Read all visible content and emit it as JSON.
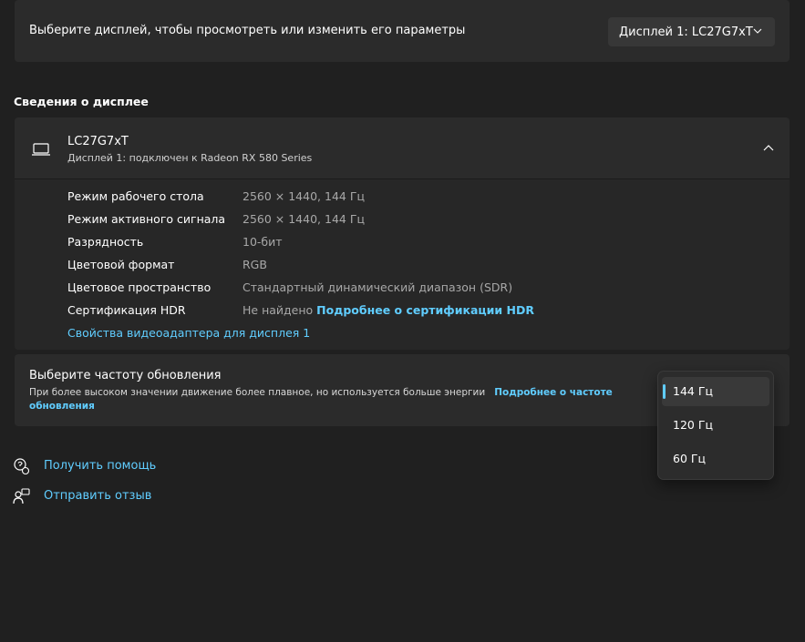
{
  "display_select": {
    "prompt": "Выберите дисплей, чтобы просмотреть или изменить его параметры",
    "selected": "Дисплей 1: LC27G7xT"
  },
  "section_title": "Сведения о дисплее",
  "monitor": {
    "name": "LC27G7xT",
    "subtitle": "Дисплей 1: подключен к Radeon RX 580 Series"
  },
  "details": [
    {
      "label": "Режим рабочего стола",
      "value": "2560 × 1440, 144 Гц"
    },
    {
      "label": "Режим активного сигнала",
      "value": "2560 × 1440, 144 Гц"
    },
    {
      "label": "Разрядность",
      "value": "10-бит"
    },
    {
      "label": "Цветовой формат",
      "value": "RGB"
    },
    {
      "label": "Цветовое пространство",
      "value": "Стандартный динамический диапазон (SDR)"
    },
    {
      "label": "Сертификация HDR",
      "value": "Не найдено",
      "link": "Подробнее о сертификации HDR"
    }
  ],
  "adapter_link": "Свойства видеоадаптера для дисплея 1",
  "refresh": {
    "title": "Выберите частоту обновления",
    "description": "При более высоком значении движение более плавное, но используется больше энергии",
    "link": "Подробнее о частоте обновления",
    "options": [
      "144 Гц",
      "120 Гц",
      "60 Гц"
    ],
    "selected": "144 Гц"
  },
  "help": {
    "get_help": "Получить помощь",
    "feedback": "Отправить отзыв"
  },
  "colors": {
    "background": "#202020",
    "card": "#2b2b2b",
    "accent": "#60cdff"
  }
}
